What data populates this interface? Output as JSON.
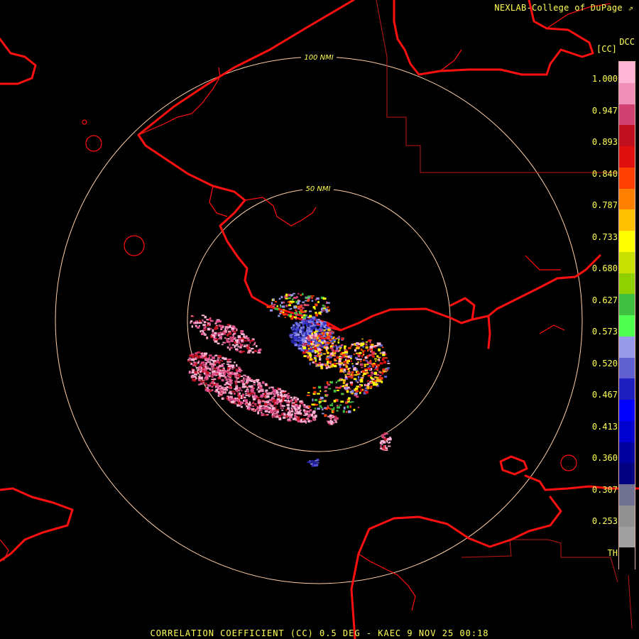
{
  "header": {
    "credit": "NEXLAB-College of DuPage",
    "product_code": "DCC",
    "unit": "[CC]"
  },
  "rings": {
    "inner_label": "50 NMI",
    "outer_label": "100 NMI"
  },
  "color_scale": {
    "ticks": [
      "1.000",
      "0.947",
      "0.893",
      "0.840",
      "0.787",
      "0.733",
      "0.680",
      "0.627",
      "0.573",
      "0.520",
      "0.467",
      "0.413",
      "0.360",
      "0.307",
      "0.253",
      "TH"
    ],
    "colors": [
      "#ffb6d6",
      "#f090b8",
      "#d04070",
      "#c01020",
      "#e01010",
      "#ff4000",
      "#ff8000",
      "#ffc000",
      "#ffff00",
      "#c8e000",
      "#90d000",
      "#40c040",
      "#50ff50",
      "#9898e8",
      "#6060d0",
      "#2020c0",
      "#0000ff",
      "#0000d0",
      "#0000a0",
      "#000080",
      "#707090",
      "#909090",
      "#a0a0a0",
      "#000000"
    ]
  },
  "colors": {
    "border": "#ff1010",
    "ring": "#ffd0a8",
    "text": "#ffff55"
  },
  "footer": {
    "text": "CORRELATION COEFFICIENT (CC) 0.5 DEG - KAEC 9 NOV 25 00:18"
  }
}
